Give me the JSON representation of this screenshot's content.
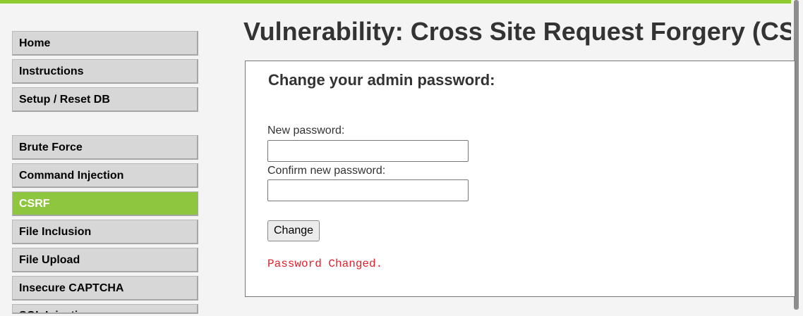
{
  "menu": {
    "group1": [
      {
        "label": "Home"
      },
      {
        "label": "Instructions"
      },
      {
        "label": "Setup / Reset DB"
      }
    ],
    "group2": [
      {
        "label": "Brute Force"
      },
      {
        "label": "Command Injection"
      },
      {
        "label": "CSRF",
        "selected": true
      },
      {
        "label": "File Inclusion"
      },
      {
        "label": "File Upload"
      },
      {
        "label": "Insecure CAPTCHA"
      },
      {
        "label": "SQL Injection"
      }
    ]
  },
  "page": {
    "title": "Vulnerability: Cross Site Request Forgery (CSRF)"
  },
  "form": {
    "heading": "Change your admin password:",
    "new_password_label": "New password:",
    "new_password_value": "",
    "confirm_password_label": "Confirm new password:",
    "confirm_password_value": "",
    "submit_label": "Change",
    "status_message": "Password Changed."
  },
  "colors": {
    "accent": "#8fc63f",
    "error_text": "#e0202a"
  }
}
